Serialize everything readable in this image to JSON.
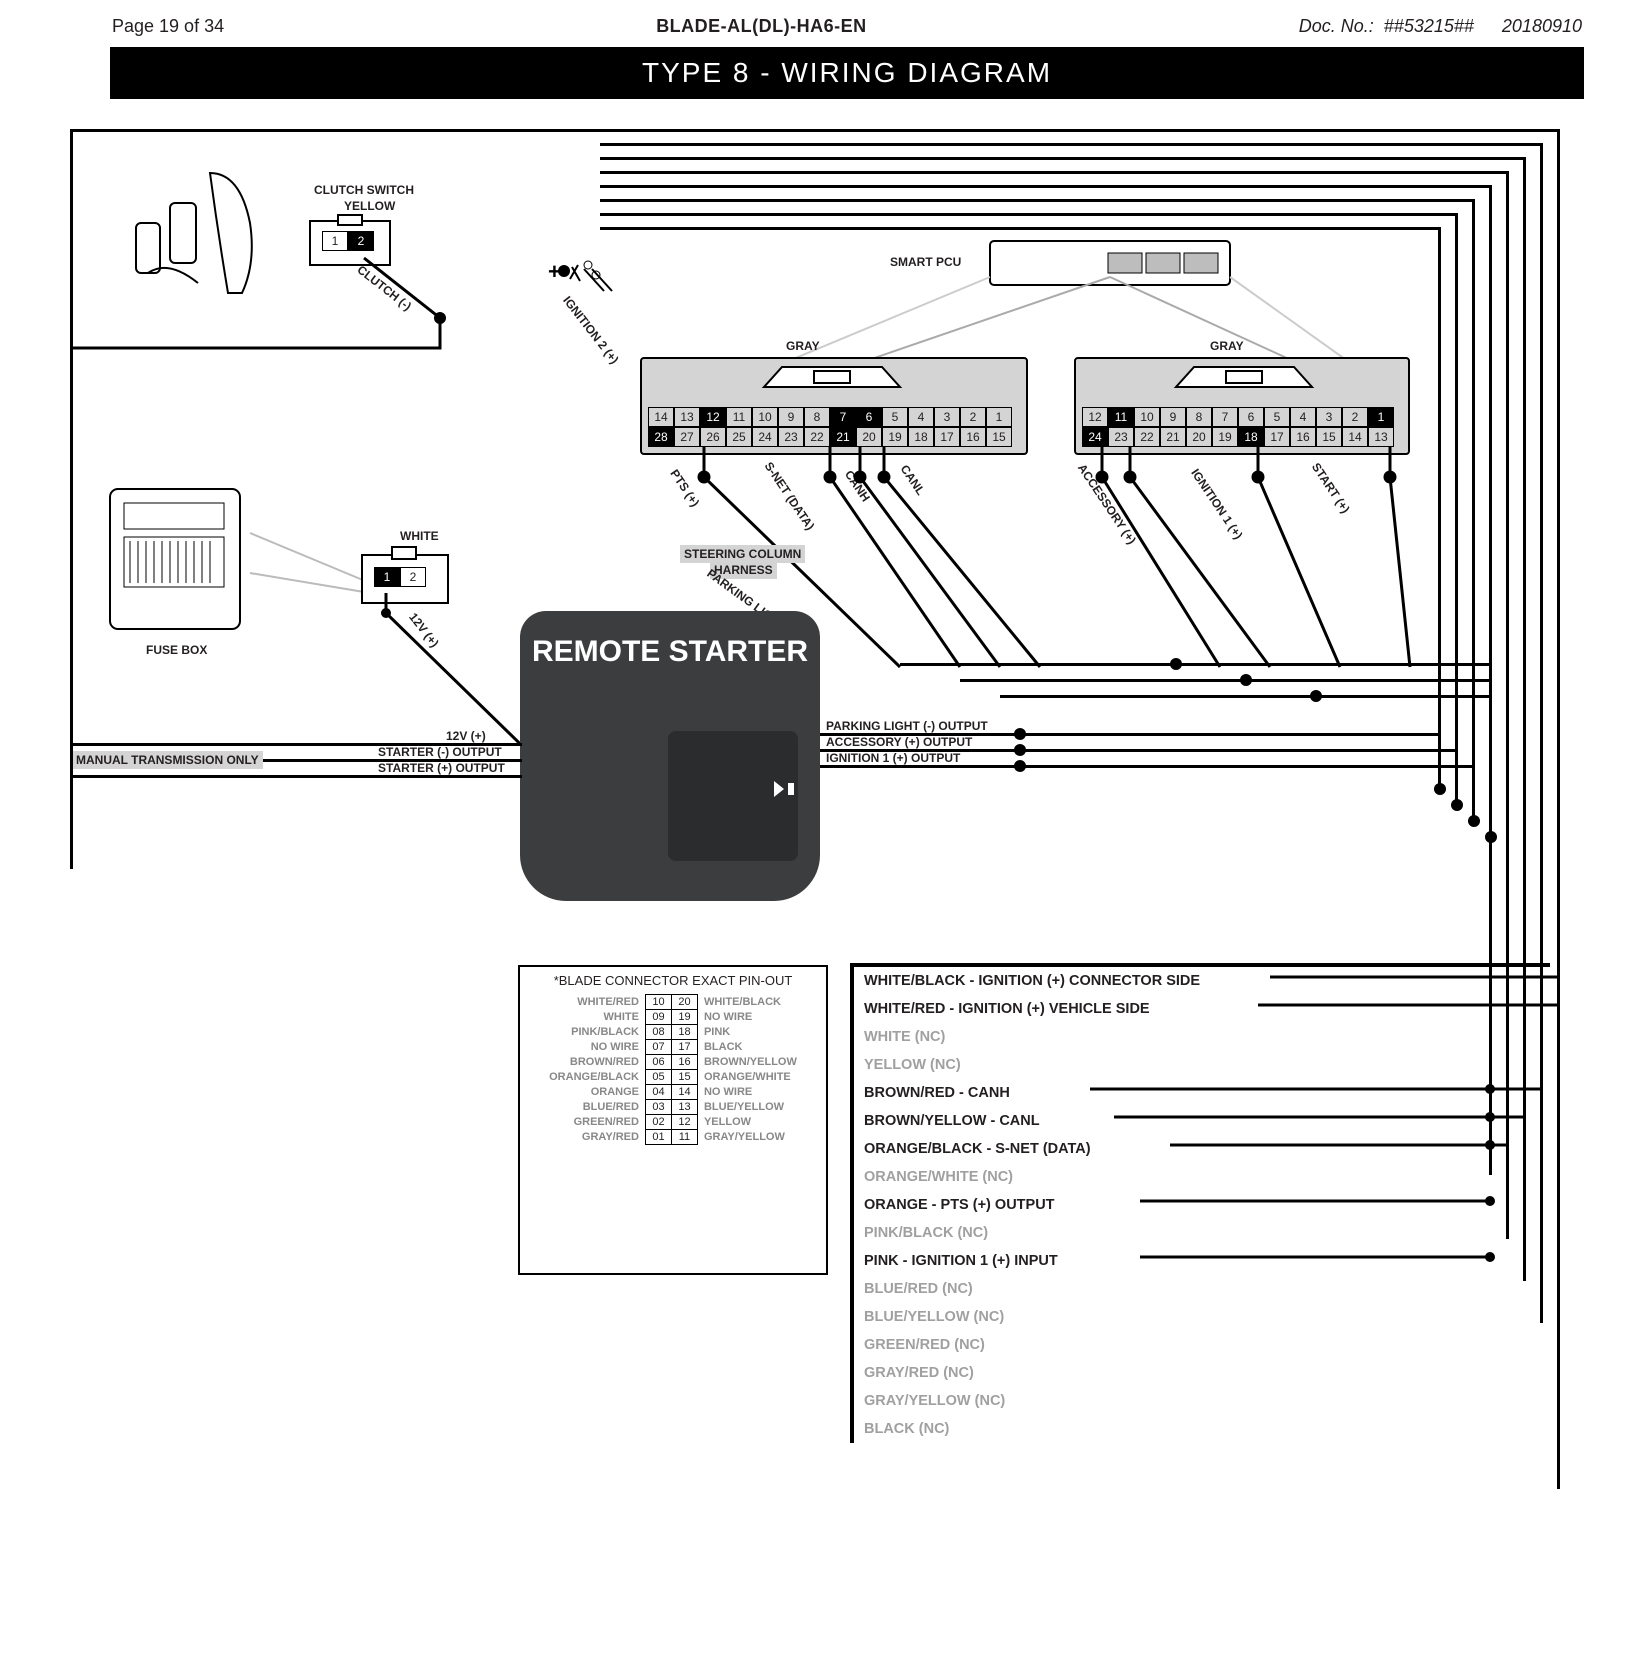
{
  "header": {
    "page": "Page 19 of 34",
    "title": "BLADE-AL(DL)-HA6-EN",
    "doc_label": "Doc. No.:",
    "doc_no": "##53215##",
    "date": "20180910"
  },
  "banner": "TYPE 8 - WIRING DIAGRAM",
  "labels": {
    "clutch_switch": "CLUTCH SWITCH",
    "clutch_yellow": "YELLOW",
    "clutch": "CLUTCH (-)",
    "smart_pcu": "SMART PCU",
    "gray_l": "GRAY",
    "gray_r": "GRAY",
    "fuse_box": "FUSE BOX",
    "white": "WHITE",
    "v12": "12V (+)",
    "ign2": "IGNITION 2 (+)",
    "pts": "PTS (+)",
    "snet": "S-NET (DATA)",
    "canh": "CANH",
    "canl": "CANL",
    "acc": "ACCESSORY (+)",
    "ign1": "IGNITION 1 (+)",
    "start": "START (+)",
    "steering": "STEERING COLUMN",
    "steering2": "HARNESS",
    "parklight": "PARKING LIGHT (-)",
    "remote_starter": "REMOTE STARTER",
    "left_12v": "12V (+)",
    "starter_neg": "STARTER (-) OUTPUT",
    "starter_pos": "STARTER (+) OUTPUT",
    "park_out": "PARKING LIGHT (-) OUTPUT",
    "acc_out": "ACCESSORY (+) OUTPUT",
    "ign1_out": "IGNITION 1 (+) OUTPUT",
    "manual": "MANUAL TRANSMISSION ONLY"
  },
  "pins_left": {
    "top": [
      "14",
      "13",
      "12",
      "11",
      "10",
      "9",
      "8",
      "7",
      "6",
      "5",
      "4",
      "3",
      "2",
      "1"
    ],
    "top_inv": [
      "12",
      "7",
      "6"
    ],
    "bot": [
      "28",
      "27",
      "26",
      "25",
      "24",
      "23",
      "22",
      "21",
      "20",
      "19",
      "18",
      "17",
      "16",
      "15"
    ],
    "bot_inv": [
      "28",
      "21"
    ]
  },
  "pins_right": {
    "top": [
      "12",
      "11",
      "10",
      "9",
      "8",
      "7",
      "6",
      "5",
      "4",
      "3",
      "2",
      "1"
    ],
    "top_inv": [
      "11",
      "1"
    ],
    "bot": [
      "24",
      "23",
      "22",
      "21",
      "20",
      "19",
      "18",
      "17",
      "16",
      "15",
      "14",
      "13"
    ],
    "bot_inv": [
      "24",
      "18"
    ]
  },
  "clutch_pins": [
    "1",
    "2"
  ],
  "white_pins": [
    "1",
    "2"
  ],
  "pinout": {
    "title": "*BLADE CONNECTOR EXACT PIN-OUT",
    "rows": [
      {
        "l": "WHITE/RED",
        "a": "10",
        "b": "20",
        "r": "WHITE/BLACK"
      },
      {
        "l": "WHITE",
        "a": "09",
        "b": "19",
        "r": "NO WIRE"
      },
      {
        "l": "PINK/BLACK",
        "a": "08",
        "b": "18",
        "r": "PINK"
      },
      {
        "l": "NO WIRE",
        "a": "07",
        "b": "17",
        "r": "BLACK"
      },
      {
        "l": "BROWN/RED",
        "a": "06",
        "b": "16",
        "r": "BROWN/YELLOW"
      },
      {
        "l": "ORANGE/BLACK",
        "a": "05",
        "b": "15",
        "r": "ORANGE/WHITE"
      },
      {
        "l": "ORANGE",
        "a": "04",
        "b": "14",
        "r": "NO WIRE"
      },
      {
        "l": "BLUE/RED",
        "a": "03",
        "b": "13",
        "r": "BLUE/YELLOW"
      },
      {
        "l": "GREEN/RED",
        "a": "02",
        "b": "12",
        "r": "YELLOW"
      },
      {
        "l": "GRAY/RED",
        "a": "01",
        "b": "11",
        "r": "GRAY/YELLOW"
      }
    ]
  },
  "wire_list": [
    {
      "t": "WHITE/BLACK - IGNITION (+) CONNECTOR SIDE",
      "g": false
    },
    {
      "t": "WHITE/RED - IGNITION (+) VEHICLE SIDE",
      "g": false
    },
    {
      "t": "WHITE (NC)",
      "g": true
    },
    {
      "t": "YELLOW (NC)",
      "g": true
    },
    {
      "t": "BROWN/RED - CANH",
      "g": false
    },
    {
      "t": "BROWN/YELLOW - CANL",
      "g": false
    },
    {
      "t": "ORANGE/BLACK - S-NET (DATA)",
      "g": false
    },
    {
      "t": "ORANGE/WHITE (NC)",
      "g": true
    },
    {
      "t": "ORANGE - PTS (+) OUTPUT",
      "g": false
    },
    {
      "t": "PINK/BLACK (NC)",
      "g": true
    },
    {
      "t": "PINK - IGNITION 1 (+) INPUT",
      "g": false
    },
    {
      "t": "BLUE/RED (NC)",
      "g": true
    },
    {
      "t": "BLUE/YELLOW (NC)",
      "g": true
    },
    {
      "t": "GREEN/RED (NC)",
      "g": true
    },
    {
      "t": "GRAY/RED (NC)",
      "g": true
    },
    {
      "t": "GRAY/YELLOW (NC)",
      "g": true
    },
    {
      "t": "BLACK (NC)",
      "g": true
    }
  ]
}
